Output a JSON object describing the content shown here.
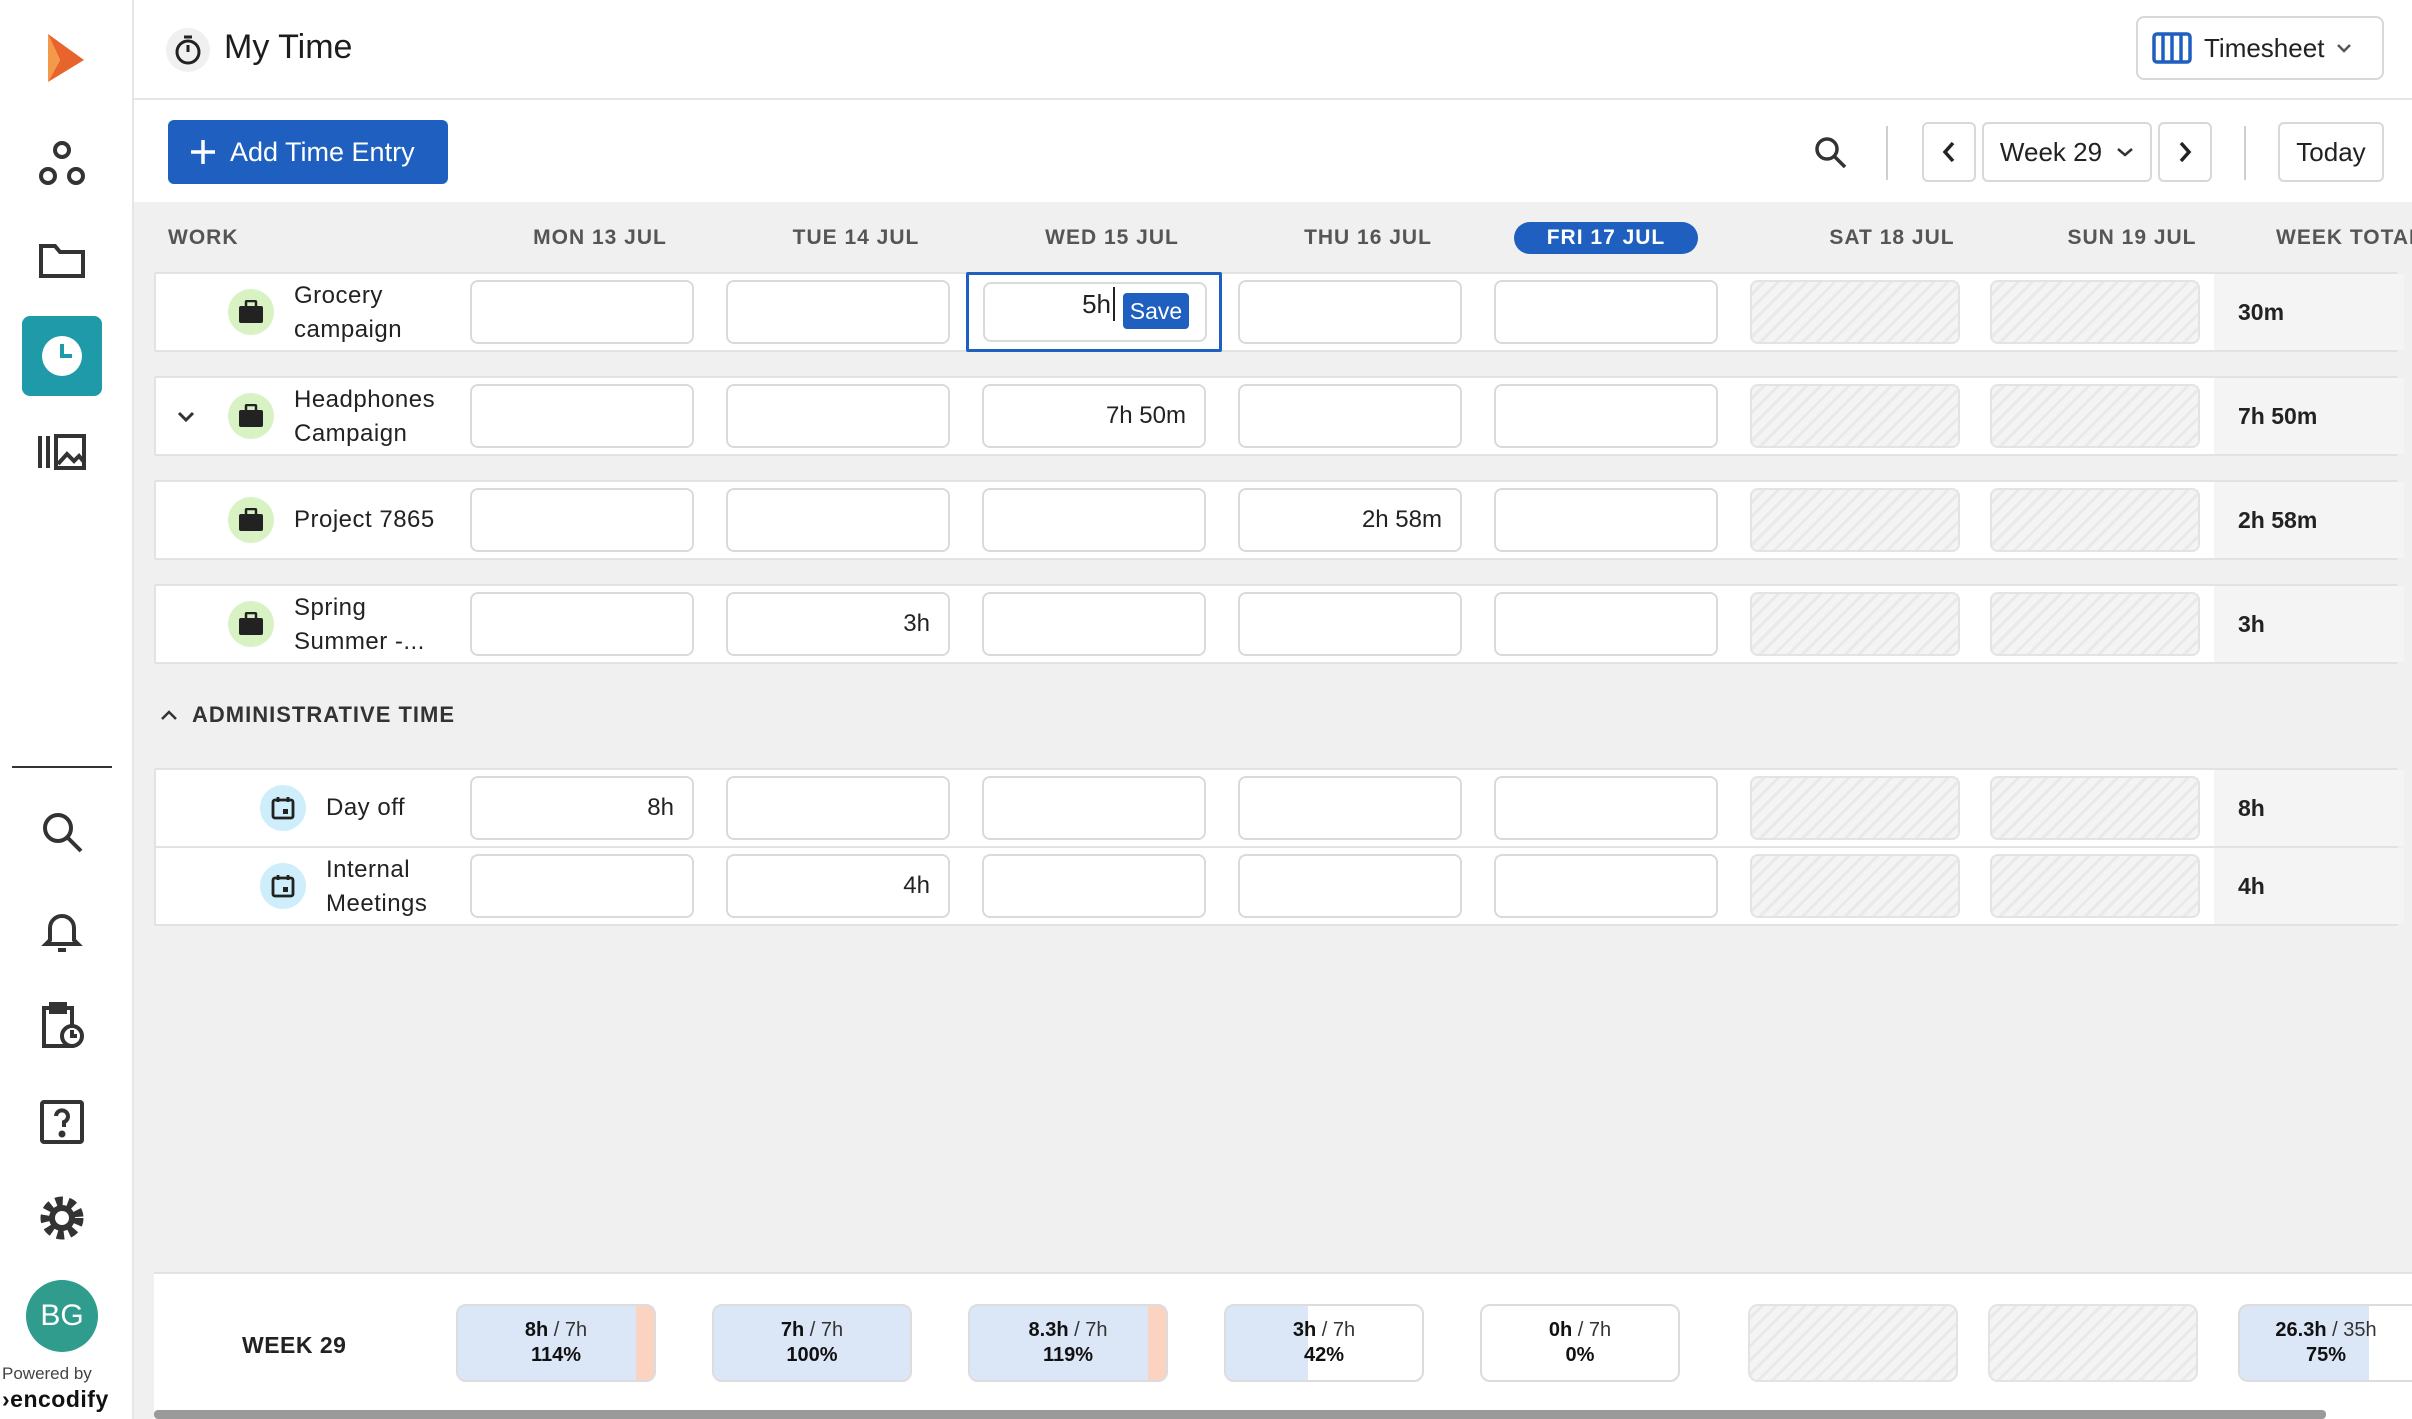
{
  "header": {
    "title": "My Time",
    "view_switch_label": "Timesheet"
  },
  "toolbar": {
    "add_label": "Add Time Entry",
    "week_label": "Week 29",
    "today_label": "Today"
  },
  "columns": {
    "work": "WORK",
    "days": [
      "MON 13 JUL",
      "TUE 14 JUL",
      "WED 15 JUL",
      "THU 16 JUL",
      "FRI 17 JUL",
      "SAT 18 JUL",
      "SUN 19 JUL"
    ],
    "week_total": "WEEK TOTAL",
    "today_index": 4
  },
  "work_rows": [
    {
      "name_line1": "Grocery",
      "name_line2": "campaign",
      "values": [
        "",
        "",
        "5h",
        "",
        "",
        "",
        ""
      ],
      "total": "30m",
      "editing_index": 2
    },
    {
      "name_line1": "Headphones",
      "name_line2": "Campaign",
      "values": [
        "",
        "",
        "7h 50m",
        "",
        "",
        "",
        ""
      ],
      "total": "7h 50m"
    },
    {
      "name_line1": "Project 7865",
      "name_line2": "",
      "values": [
        "",
        "",
        "",
        "2h 58m",
        "",
        "",
        ""
      ],
      "total": "2h 58m"
    },
    {
      "name_line1": "Spring",
      "name_line2": "Summer -...",
      "values": [
        "",
        "3h",
        "",
        "",
        "",
        "",
        ""
      ],
      "total": "3h"
    }
  ],
  "save_label": "Save",
  "admin": {
    "heading": "ADMINISTRATIVE TIME",
    "rows": [
      {
        "name_line1": "Day off",
        "name_line2": "",
        "values": [
          "8h",
          "",
          "",
          "",
          "",
          "",
          ""
        ],
        "total": "8h"
      },
      {
        "name_line1": "Internal",
        "name_line2": "Meetings",
        "values": [
          "",
          "4h",
          "",
          "",
          "",
          "",
          ""
        ],
        "total": "4h"
      }
    ]
  },
  "summary": {
    "label": "WEEK 29",
    "days": [
      {
        "logged": "8h",
        "target": "/ 7h",
        "pct": "114%",
        "fill": 1.0,
        "over": true
      },
      {
        "logged": "7h",
        "target": "/ 7h",
        "pct": "100%",
        "fill": 1.0,
        "over": false
      },
      {
        "logged": "8.3h",
        "target": "/ 7h",
        "pct": "119%",
        "fill": 1.0,
        "over": true
      },
      {
        "logged": "3h",
        "target": "/ 7h",
        "pct": "42%",
        "fill": 0.42,
        "over": false
      },
      {
        "logged": "0h",
        "target": "/ 7h",
        "pct": "0%",
        "fill": 0,
        "over": false
      }
    ],
    "week": {
      "logged": "26.3h",
      "target": "/ 35h",
      "pct": "75%",
      "fill": 0.75
    }
  },
  "sidebar": {
    "avatar_initials": "BG",
    "powered_by": "Powered by",
    "brand": "encodify"
  },
  "colors": {
    "accent": "#1f5fbf",
    "active_nav": "#1e9aa8",
    "row_icon_work": "#d8f2c4",
    "row_icon_admin": "#cdeefa",
    "overtime": "#fbd3c0"
  }
}
